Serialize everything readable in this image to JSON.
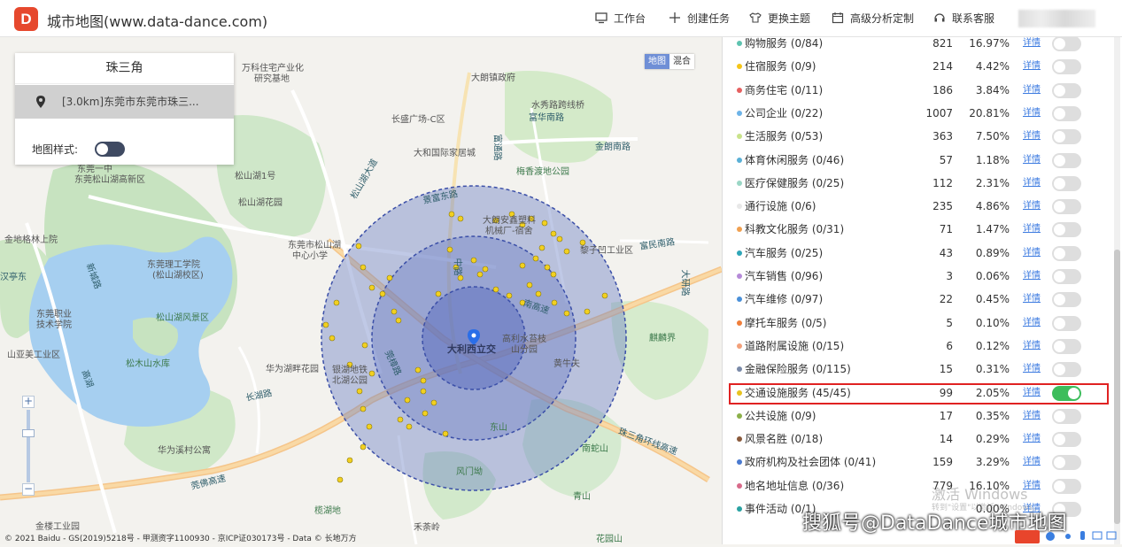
{
  "header": {
    "logo_letter": "D",
    "title": "城市地图(www.data-dance.com)",
    "nav": [
      {
        "label": "工作台",
        "icon": "monitor-icon"
      },
      {
        "label": "创建任务",
        "icon": "plus-icon"
      },
      {
        "label": "更换主题",
        "icon": "shirt-icon"
      },
      {
        "label": "高级分析定制",
        "icon": "calendar-icon"
      },
      {
        "label": "联系客服",
        "icon": "headset-icon"
      }
    ]
  },
  "region_panel": {
    "title": "珠三角",
    "item": "[3.0km]东莞市东莞市珠三...",
    "style_label": "地图样式:"
  },
  "map_type": {
    "active": "地图",
    "other": "混合"
  },
  "zoom": {
    "plus": "+",
    "minus": "−"
  },
  "copyright": "© 2021 Baidu - GS(2019)5218号 - 甲测资字1100930 - 京ICP证030173号 - Data © 长地万方",
  "map_labels": {
    "l1": "万科住宅产业化",
    "l2": "研究基地",
    "l3": "大朗镇政府",
    "l4": "水秀路跨线桥",
    "l5": "长盛广场-C区",
    "l6": "富华南路",
    "l7": "大和国际家居城",
    "l8": "金朗南路",
    "l9": "松山湖1号",
    "l10": "松山湖花园",
    "l11": "东莞市松山湖",
    "l12": "中心小学",
    "l13": "东莞理工学院",
    "l14": "(松山湖校区)",
    "l15": "东莞职业",
    "l16": "技术学院",
    "l17": "松山湖风景区",
    "l18": "松木山水库",
    "l19": "华为湖畔花园",
    "l20": "银湖地铁",
    "l21": "北湖公园",
    "l22": "华为溪村公寓",
    "l23": "莞佛高速",
    "l24": "新城路",
    "l25": "大朗安鑫塑料",
    "l26": "机械厂-宿舍",
    "l27": "富民南路",
    "l28": "黎子凹工业区",
    "l29": "大利西立交",
    "l30": "高利水苔枝",
    "l31": "山分园",
    "l32": "黄牛夫",
    "l33": "东山",
    "l34": "风门坳",
    "l35": "南蛇山",
    "l36": "青山",
    "l37": "麒麟界",
    "l38": "珠三角环线高速",
    "l39": "南高速",
    "l40": "景富东路",
    "l41": "松山湖大道",
    "l42": "金地格林上院",
    "l43": "金楼工业园",
    "l44": "榄湖地",
    "l45": "花园山",
    "l46": "山亚美工业区",
    "l47": "东莞一中",
    "l48": "汉亭东",
    "l49": "莞樟路",
    "l50": "长湖路",
    "l51": "高湖",
    "l52": "中路",
    "l53": "富通路",
    "l54": "梅香渡地公园",
    "l55": "大研路",
    "l56": "东莞松山湖高新区",
    "l57": "禾荼岭"
  },
  "categories": [
    {
      "name": "购物服务 (0/84)",
      "count": "821",
      "pct": "16.97%",
      "color": "#5ec3b0",
      "on": false
    },
    {
      "name": "住宿服务 (0/9)",
      "count": "214",
      "pct": "4.42%",
      "color": "#f5c518",
      "on": false
    },
    {
      "name": "商务住宅 (0/11)",
      "count": "186",
      "pct": "3.84%",
      "color": "#e66060",
      "on": false
    },
    {
      "name": "公司企业 (0/22)",
      "count": "1007",
      "pct": "20.81%",
      "color": "#6db3e8",
      "on": false
    },
    {
      "name": "生活服务 (0/53)",
      "count": "363",
      "pct": "7.50%",
      "color": "#c9e38a",
      "on": false
    },
    {
      "name": "体育休闲服务 (0/46)",
      "count": "57",
      "pct": "1.18%",
      "color": "#5ab0d6",
      "on": false
    },
    {
      "name": "医疗保健服务 (0/25)",
      "count": "112",
      "pct": "2.31%",
      "color": "#9ad6c5",
      "on": false
    },
    {
      "name": "通行设施 (0/6)",
      "count": "235",
      "pct": "4.86%",
      "color": "#e8e8e8",
      "on": false
    },
    {
      "name": "科教文化服务 (0/31)",
      "count": "71",
      "pct": "1.47%",
      "color": "#f0a050",
      "on": false
    },
    {
      "name": "汽车服务 (0/25)",
      "count": "43",
      "pct": "0.89%",
      "color": "#2fa6b8",
      "on": false
    },
    {
      "name": "汽车销售 (0/96)",
      "count": "3",
      "pct": "0.06%",
      "color": "#b58ad8",
      "on": false
    },
    {
      "name": "汽车维修 (0/97)",
      "count": "22",
      "pct": "0.45%",
      "color": "#4a90d9",
      "on": false
    },
    {
      "name": "摩托车服务 (0/5)",
      "count": "5",
      "pct": "0.10%",
      "color": "#f07e3a",
      "on": false
    },
    {
      "name": "道路附属设施 (0/15)",
      "count": "6",
      "pct": "0.12%",
      "color": "#f2a07a",
      "on": false
    },
    {
      "name": "金融保险服务 (0/115)",
      "count": "15",
      "pct": "0.31%",
      "color": "#7a8aa8",
      "on": false
    },
    {
      "name": "交通设施服务 (45/45)",
      "count": "99",
      "pct": "2.05%",
      "color": "#e8c320",
      "on": true
    },
    {
      "name": "公共设施 (0/9)",
      "count": "17",
      "pct": "0.35%",
      "color": "#8bb04a",
      "on": false
    },
    {
      "name": "风景名胜 (0/18)",
      "count": "14",
      "pct": "0.29%",
      "color": "#8a5a3c",
      "on": false
    },
    {
      "name": "政府机构及社会团体 (0/41)",
      "count": "159",
      "pct": "3.29%",
      "color": "#4a7ad0",
      "on": false
    },
    {
      "name": "地名地址信息 (0/36)",
      "count": "779",
      "pct": "16.10%",
      "color": "#d86a8a",
      "on": false
    },
    {
      "name": "事件活动 (0/1)",
      "count": "",
      "pct": "0.00%",
      "color": "#2aa2a2",
      "on": false
    }
  ],
  "detail_label": "详情",
  "watermark": {
    "win1": "激活 Windows",
    "win2": "转到\"设置\"以激活 Windows。",
    "sohu": "搜狐号@DataDance城市地图"
  }
}
